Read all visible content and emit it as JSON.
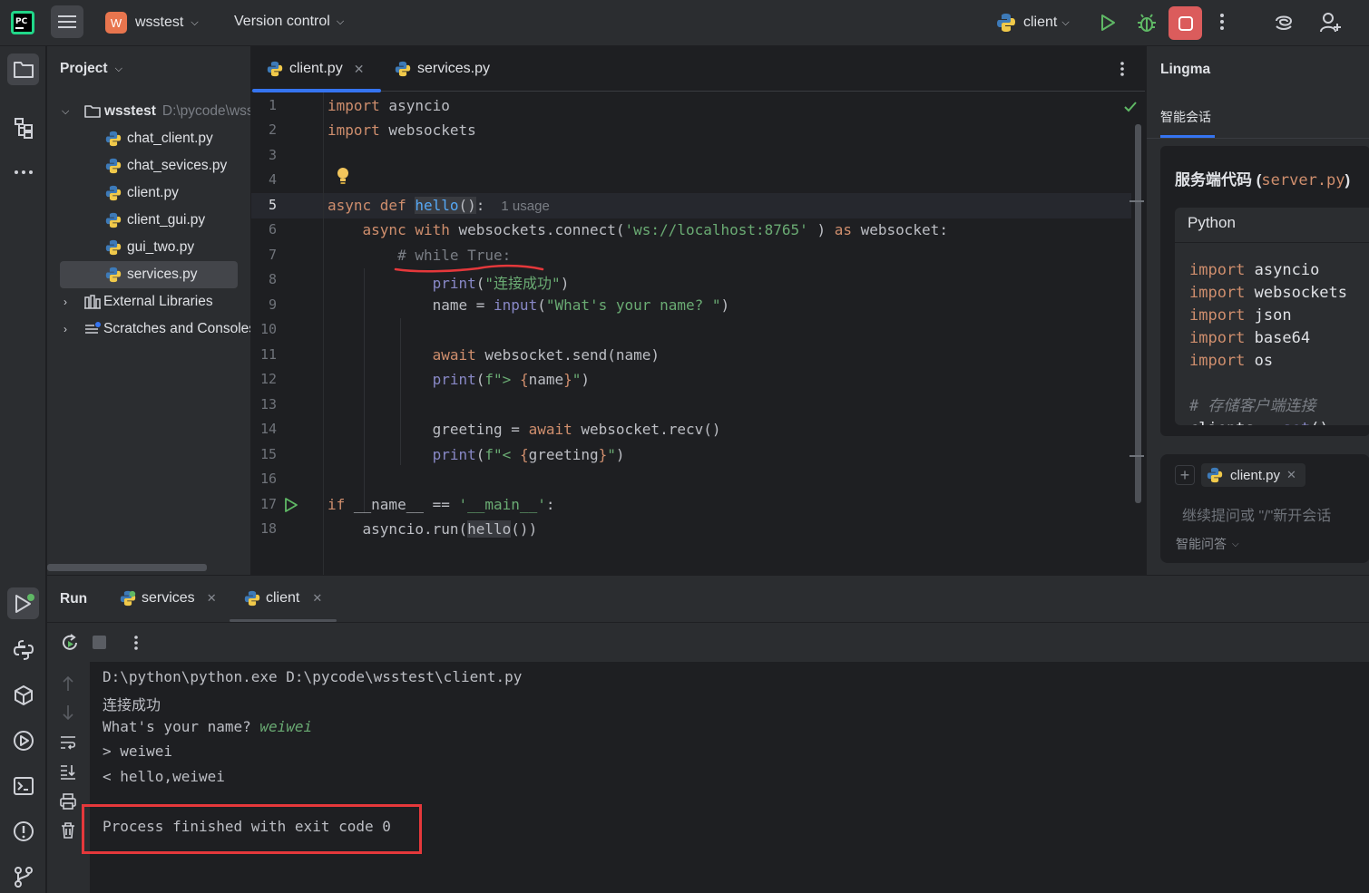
{
  "titlebar": {
    "project_badge": "W",
    "project_name": "wsstest",
    "vcs": "Version control",
    "run_config": "client"
  },
  "project": {
    "header": "Project",
    "root": {
      "name": "wsstest",
      "path": "D:\\pycode\\wsstest"
    },
    "files": [
      "chat_client.py",
      "chat_sevices.py",
      "client.py",
      "client_gui.py",
      "gui_two.py",
      "services.py"
    ],
    "selected": "services.py",
    "external": "External Libraries",
    "scratches": "Scratches and Consoles"
  },
  "editor": {
    "tabs": [
      "client.py",
      "services.py"
    ],
    "active_tab": "client.py",
    "usage_hint": "1 usage",
    "line_numbers": [
      "1",
      "2",
      "3",
      "4",
      "5",
      "6",
      "7",
      "8",
      "9",
      "10",
      "11",
      "12",
      "13",
      "14",
      "15",
      "16",
      "17",
      "18"
    ]
  },
  "lingma": {
    "title": "Lingma",
    "tab": "智能会话",
    "heading_text": "服务端代码",
    "heading_code": "server.py",
    "code_lang": "Python",
    "code_lines": [
      "import asyncio",
      "import websockets",
      "import json",
      "import base64",
      "import os",
      "",
      "# 存储客户端连接",
      "clients = set()"
    ],
    "context_file": "client.py",
    "input_placeholder": "继续提问或 \"/\"新开会话",
    "mode": "智能问答"
  },
  "run": {
    "title": "Run",
    "tabs": [
      "services",
      "client"
    ],
    "active_tab": "client",
    "console": {
      "command": "D:\\python\\python.exe D:\\pycode\\wsstest\\client.py",
      "line1": "连接成功",
      "prompt": "What's your name? ",
      "user_input": "weiwei",
      "sent": "> weiwei",
      "received": "< hello,weiwei",
      "exit": "Process finished with exit code 0"
    }
  },
  "colors": {
    "accent": "#3574f0",
    "stop": "#db5c5c",
    "annotation": "#e5383b",
    "run_green": "#5fb865"
  }
}
